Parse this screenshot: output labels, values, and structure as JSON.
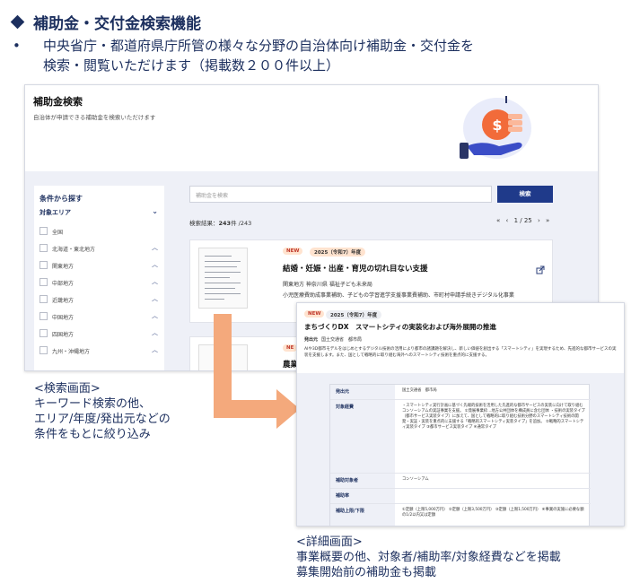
{
  "slide": {
    "title": "補助金・交付金検索機能",
    "bullet_mark": "•",
    "bullet_line1": "中央省庁・都道府県庁所管の様々な分野の自治体向け補助金・交付金を",
    "bullet_line2": "検索・閲覧いただけます（掲載数２００件以上）"
  },
  "search_screen": {
    "title": "補助金検索",
    "subtitle": "自治体が申請できる補助金を検索いただけます",
    "sidebar": {
      "heading": "条件から探す",
      "area_label": "対象エリア",
      "items": [
        {
          "label": "全国",
          "expandable": false
        },
        {
          "label": "北海道・東北地方",
          "expandable": true
        },
        {
          "label": "関東地方",
          "expandable": true
        },
        {
          "label": "中部地方",
          "expandable": true
        },
        {
          "label": "近畿地方",
          "expandable": true
        },
        {
          "label": "中国地方",
          "expandable": true
        },
        {
          "label": "四国地方",
          "expandable": true
        },
        {
          "label": "九州・沖縄地方",
          "expandable": true
        }
      ]
    },
    "search_placeholder": "補助金を検索",
    "search_button": "検索",
    "result_label": "検索結果：",
    "result_count": "243",
    "result_suffix": "件 /243",
    "pager": {
      "first": "«",
      "prev": "‹",
      "page": "1 / 25",
      "next": "›",
      "last": "»"
    },
    "card1": {
      "badge_new": "NEW",
      "badge_year": "2025（令和7）年度",
      "title": "結婚・妊娠・出産・育児の切れ目ない支援",
      "meta": "関東地方 神奈川県 福祉子ども未来局",
      "desc": "小児医療費助成事業補助、子どもの学習進学支援事業費補助、市町村申請手続きデジタル化事業"
    },
    "card2": {
      "badge_new": "NE",
      "title": "農業"
    }
  },
  "detail_screen": {
    "badge_new": "NEW",
    "badge_year": "2025（令和7）年度",
    "title": "まちづくりDX　スマートシティの実装化および海外展開の推進",
    "issuer_label": "発出元",
    "issuer_value": "国土交通省　都市局",
    "summary": "AIや3D都市モデルをはじめとするデジタル技術の活用により都市の諸課題を解決し、新しい価値を創出する「スマートシティ」を実現するため、先進的な都市サービスの実装を支援します。また、国として戦略的に取り組む海外へのスマートシティ技術を重点的に支援する。",
    "rows": [
      {
        "key": "発出元",
        "value": "国土交通省　都市局"
      },
      {
        "key": "対象経費",
        "value": "・スマートシティ実行計画に基づく先端的技術を活用した先進的な都市サービスの実装に向けて取り組むコンソーシアムの実証事業を支援。 ①発展事業枠…地方公共団体を構成員に含む団体 ・技術の実装タイプ（都市サービス実装タイプ）に加えて、国として戦略的に取り組む技術分野のスマートシティ技術の開発・実証・実装を重点的に支援する「戦略的スマートシティ実装タイプ」を追加。 ②戦略的スマートシティ実装タイプ ③都市サービス実装タイプ ④通常タイプ"
      },
      {
        "key": "補助対象者",
        "value": "コンソーシアム"
      },
      {
        "key": "補助率",
        "value": ""
      },
      {
        "key": "補助上限/下限",
        "value": "①定額（上限5,000万円） ②定額（上限3,500万円） ③定額（上限1,500万円） ④事業の実施に必要な額の1/2以内又は定額"
      }
    ]
  },
  "captions": {
    "search_heading": "<検索画面>",
    "search_line1": "キーワード検索の他、",
    "search_line2": "エリア/年度/発出元などの",
    "search_line3": "条件をもとに絞り込み",
    "detail_heading": "<詳細画面>",
    "detail_line1": "事業概要の他、対象者/補助率/対象経費などを掲載",
    "detail_line2": "募集開始前の補助金も掲載"
  },
  "colors": {
    "navy": "#1c2f5e",
    "button": "#1f3a8a",
    "arrow": "#f4a97c",
    "coin": "#f26b3a"
  }
}
